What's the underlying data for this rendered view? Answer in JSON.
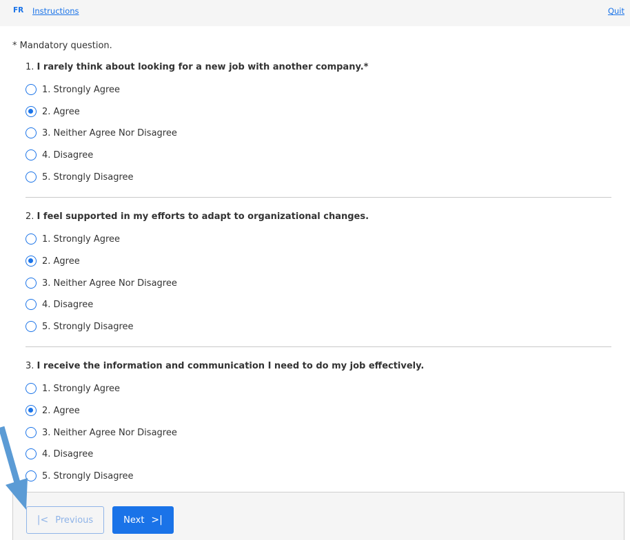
{
  "header": {
    "language": "FR",
    "instructions": "Instructions",
    "quit": "Quit"
  },
  "mandatory_note": "* Mandatory question.",
  "questions": [
    {
      "number": "1.",
      "text": "I rarely think about looking for a new job with another company.*",
      "options": [
        "1. Strongly Agree",
        "2. Agree",
        "3. Neither Agree Nor Disagree",
        "4. Disagree",
        "5. Strongly Disagree"
      ],
      "selected": "2. Agree"
    },
    {
      "number": "2.",
      "text": "I feel supported in my efforts to adapt to organizational changes.",
      "options": [
        "1. Strongly Agree",
        "2. Agree",
        "3. Neither Agree Nor Disagree",
        "4. Disagree",
        "5. Strongly Disagree"
      ],
      "selected": "2. Agree"
    },
    {
      "number": "3.",
      "text": "I receive the information and communication I need to do my job effectively.",
      "options": [
        "1. Strongly Agree",
        "2. Agree",
        "3. Neither Agree Nor Disagree",
        "4. Disagree",
        "5. Strongly Disagree"
      ],
      "selected": "2. Agree"
    }
  ],
  "footer": {
    "previous_label": "Previous",
    "next_label": "Next"
  },
  "colors": {
    "accent": "#1a73e8",
    "annotation_arrow": "#5b9bd5"
  },
  "icons": {
    "previous": "first-page-icon",
    "next": "last-page-icon",
    "annotation": "arrow-pointer-icon"
  }
}
